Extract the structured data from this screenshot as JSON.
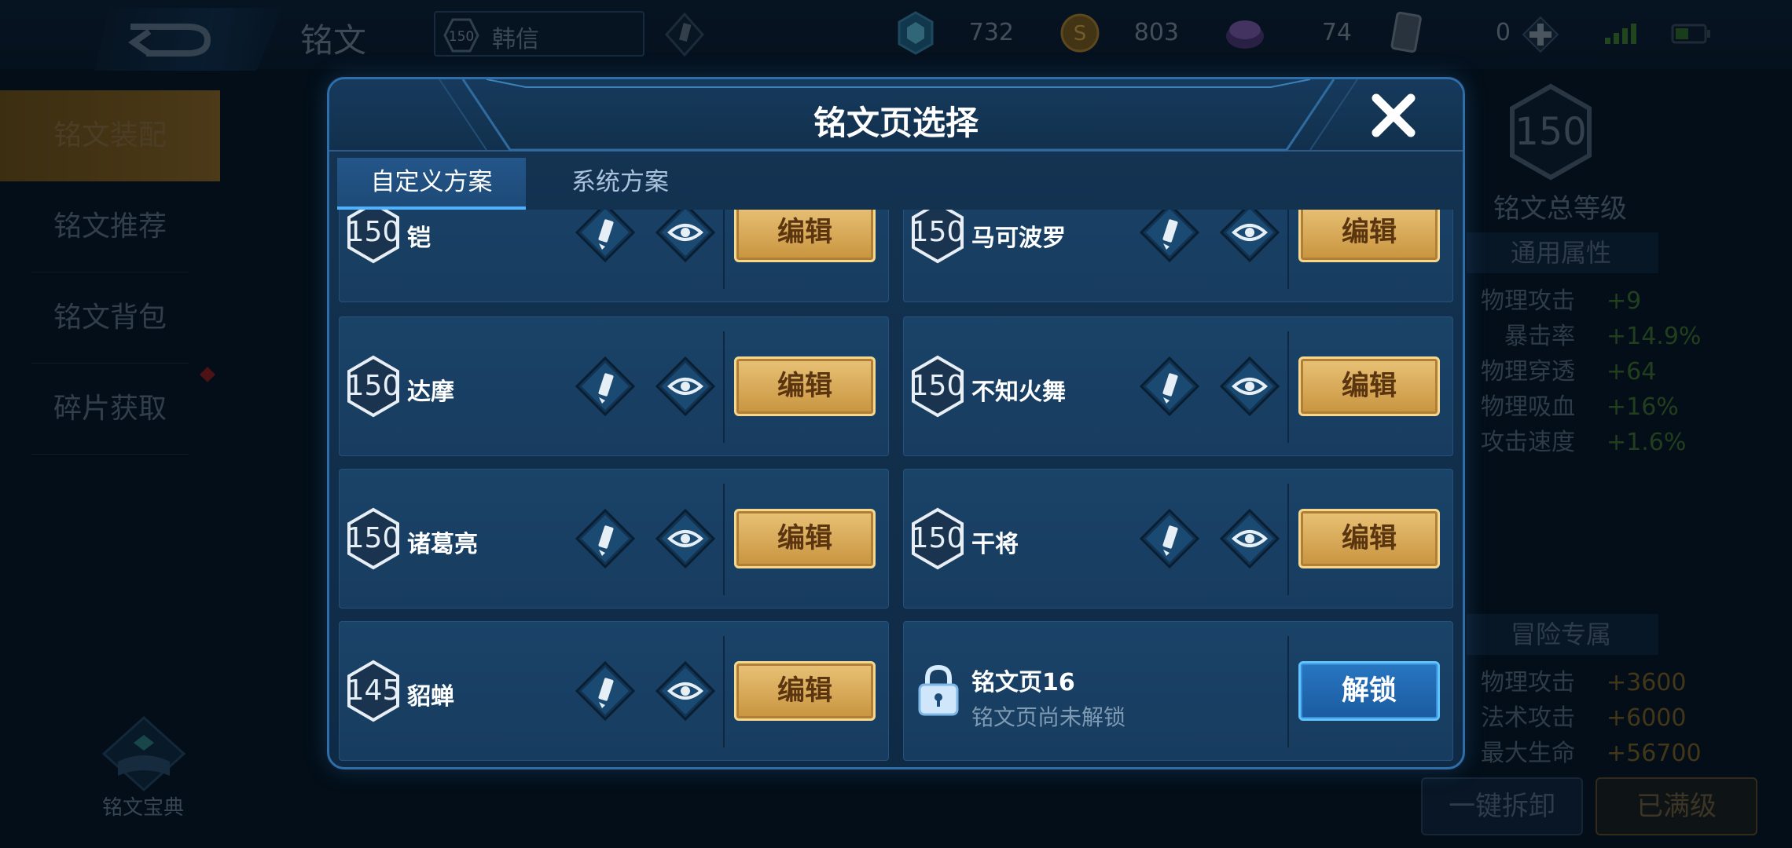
{
  "topbar": {
    "title": "铭文",
    "hero_level": "150",
    "hero_name": "韩信",
    "currencies": [
      {
        "icon": "crystal-icon",
        "value": "732"
      },
      {
        "icon": "gold-coin-icon",
        "value": "803"
      },
      {
        "icon": "purple-gem-icon",
        "value": "74"
      },
      {
        "icon": "card-icon",
        "value": "0"
      }
    ]
  },
  "sidebar": {
    "items": [
      {
        "label": "铭文装配",
        "active": true
      },
      {
        "label": "铭文推荐"
      },
      {
        "label": "铭文背包"
      },
      {
        "label": "碎片获取"
      }
    ],
    "book_label": "铭文宝典"
  },
  "right_panel": {
    "total_level": "150",
    "total_label": "铭文总等级",
    "general_header": "通用属性",
    "general_attrs": [
      {
        "name": "物理攻击",
        "value": "+9"
      },
      {
        "name": "暴击率",
        "value": "+14.9%"
      },
      {
        "name": "物理穿透",
        "value": "+64"
      },
      {
        "name": "物理吸血",
        "value": "+16%"
      },
      {
        "name": "攻击速度",
        "value": "+1.6%"
      }
    ],
    "adventure_header": "冒险专属",
    "adventure_attrs": [
      {
        "name": "物理攻击",
        "value": "+3600"
      },
      {
        "name": "法术攻击",
        "value": "+6000"
      },
      {
        "name": "最大生命",
        "value": "+56700"
      }
    ],
    "unload_button": "一键拆卸",
    "maxed_button": "已满级"
  },
  "modal": {
    "title": "铭文页选择",
    "tabs": [
      "自定义方案",
      "系统方案"
    ],
    "pages": [
      {
        "level": "150",
        "name": "铠",
        "button": "编辑"
      },
      {
        "level": "150",
        "name": "马可波罗",
        "button": "编辑"
      },
      {
        "level": "150",
        "name": "达摩",
        "button": "编辑"
      },
      {
        "level": "150",
        "name": "不知火舞",
        "button": "编辑"
      },
      {
        "level": "150",
        "name": "诸葛亮",
        "button": "编辑"
      },
      {
        "level": "150",
        "name": "干将",
        "button": "编辑"
      },
      {
        "level": "145",
        "name": "貂蝉",
        "button": "编辑"
      }
    ],
    "locked_page": {
      "title": "铭文页16",
      "subtitle": "铭文页尚未解锁",
      "button": "解锁"
    }
  },
  "colors": {
    "accent_gold": "#e9c277",
    "accent_blue": "#2876c2",
    "panel_blue": "#173c5f"
  }
}
